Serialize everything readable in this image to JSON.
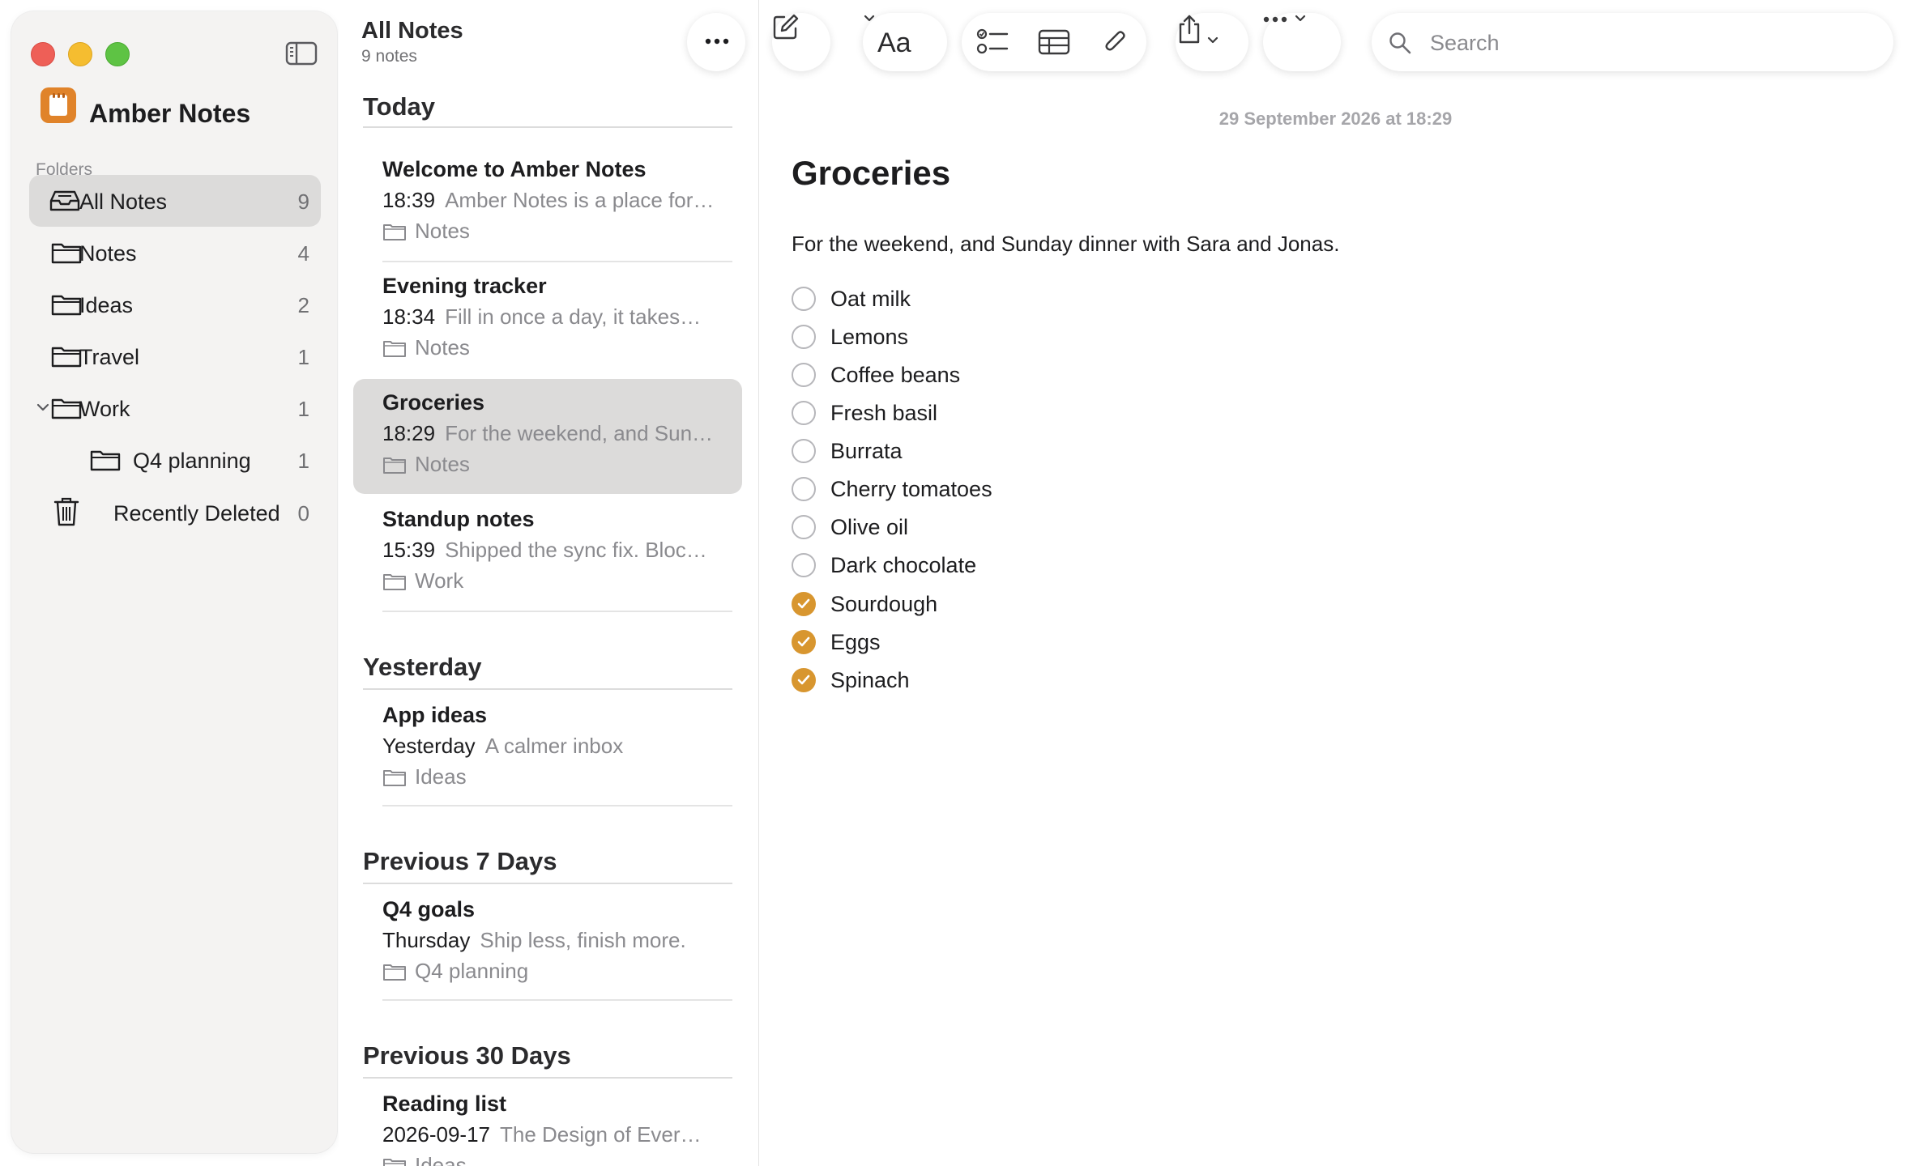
{
  "app": {
    "name": "Amber Notes"
  },
  "colors": {
    "accent": "#d8962f",
    "selected": "#dcdbda",
    "sidebar_bg": "#f4f3f2"
  },
  "sidebar": {
    "folders_label": "Folders",
    "folders": [
      {
        "name": "All Notes",
        "count": "9",
        "icon": "tray-icon",
        "selected": true
      },
      {
        "name": "Notes",
        "count": "4",
        "icon": "folder-icon"
      },
      {
        "name": "Ideas",
        "count": "2",
        "icon": "folder-icon"
      },
      {
        "name": "Travel",
        "count": "1",
        "icon": "folder-icon"
      },
      {
        "name": "Work",
        "count": "1",
        "icon": "folder-icon",
        "expanded": true
      },
      {
        "name": "Q4 planning",
        "count": "1",
        "icon": "folder-icon",
        "nested": true
      },
      {
        "name": "Recently Deleted",
        "count": "0",
        "icon": "trash-icon"
      }
    ]
  },
  "list": {
    "title": "All Notes",
    "count": "9 notes",
    "sections": [
      {
        "label": "Today",
        "notes": [
          {
            "title": "Welcome to Amber Notes",
            "time": "18:39",
            "preview": "Amber Notes is a place for…",
            "folder": "Notes"
          },
          {
            "title": "Evening tracker",
            "time": "18:34",
            "preview": "Fill in once a day, it takes…",
            "folder": "Notes"
          },
          {
            "title": "Groceries",
            "time": "18:29",
            "preview": "For the weekend, and Sun…",
            "folder": "Notes",
            "selected": true
          },
          {
            "title": "Standup notes",
            "time": "15:39",
            "preview": "Shipped the sync fix. Bloc…",
            "folder": "Work"
          }
        ]
      },
      {
        "label": "Yesterday",
        "notes": [
          {
            "title": "App ideas",
            "time": "Yesterday",
            "preview": "A calmer inbox",
            "folder": "Ideas"
          }
        ]
      },
      {
        "label": "Previous 7 Days",
        "notes": [
          {
            "title": "Q4 goals",
            "time": "Thursday",
            "preview": "Ship less, finish more.",
            "folder": "Q4 planning"
          }
        ]
      },
      {
        "label": "Previous 30 Days",
        "notes": [
          {
            "title": "Reading list",
            "time": "2026-09-17",
            "preview": "The Design of Ever…",
            "folder": "Ideas"
          }
        ]
      }
    ]
  },
  "toolbar": {
    "format_label": "Aa",
    "search_placeholder": "Search"
  },
  "editor": {
    "date": "29 September 2026 at 18:29",
    "title": "Groceries",
    "body": "For the weekend, and Sunday dinner with Sara and Jonas.",
    "checklist": [
      {
        "label": "Oat milk",
        "done": false
      },
      {
        "label": "Lemons",
        "done": false
      },
      {
        "label": "Coffee beans",
        "done": false
      },
      {
        "label": "Fresh basil",
        "done": false
      },
      {
        "label": "Burrata",
        "done": false
      },
      {
        "label": "Cherry tomatoes",
        "done": false
      },
      {
        "label": "Olive oil",
        "done": false
      },
      {
        "label": "Dark chocolate",
        "done": false
      },
      {
        "label": "Sourdough",
        "done": true
      },
      {
        "label": "Eggs",
        "done": true
      },
      {
        "label": "Spinach",
        "done": true
      }
    ]
  }
}
